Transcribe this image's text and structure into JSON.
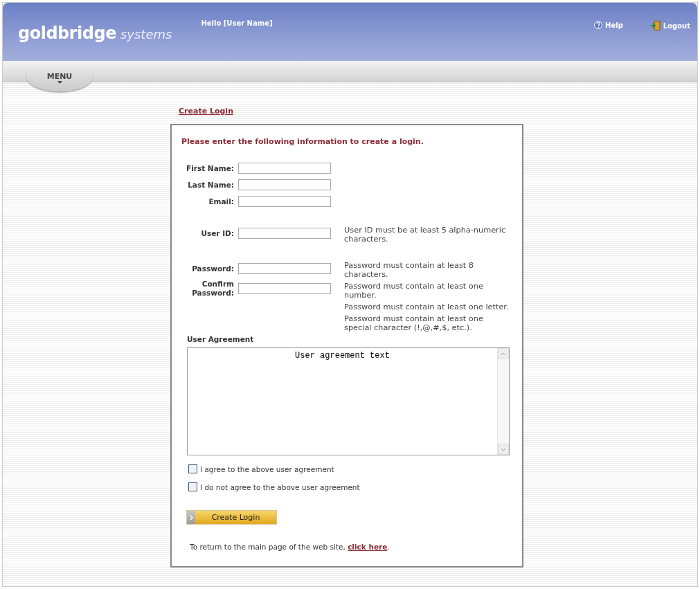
{
  "header": {
    "logo_main": "goldbridge",
    "logo_sub": "systems",
    "greeting": "Hello [User Name]",
    "help": "Help",
    "logout": "Logout"
  },
  "menu": {
    "label": "MENU"
  },
  "breadcrumb": "Create Login",
  "form": {
    "intro": "Please enter the following information to create a login.",
    "sections": [
      {
        "fields": [
          {
            "label": "First Name:"
          },
          {
            "label": "Last Name:"
          },
          {
            "label": "Email:"
          }
        ]
      },
      {
        "fields": [
          {
            "label": "User ID:"
          }
        ],
        "hints": [
          "User ID must be at least 5 alpha-numeric characters."
        ]
      },
      {
        "fields": [
          {
            "label": "Password:"
          },
          {
            "label": "Confirm Password:"
          }
        ],
        "hints": [
          "Password must contain at least 8 characters.",
          "Password must contain at least one number.",
          "Password must contain at least one letter.",
          "Password must contain at least one special character (!,@,#,$, etc.)."
        ]
      }
    ],
    "agreement_heading": "User Agreement",
    "agreement_text": "User agreement text",
    "options": [
      {
        "label": "I agree to the above user agreement",
        "checked": false
      },
      {
        "label": "I do not agree to the above user agreement",
        "checked": false
      }
    ],
    "submit": "Create Login",
    "return_text": {
      "before": "To return to the main page of the web site, ",
      "link": "click here",
      "after": "."
    }
  }
}
